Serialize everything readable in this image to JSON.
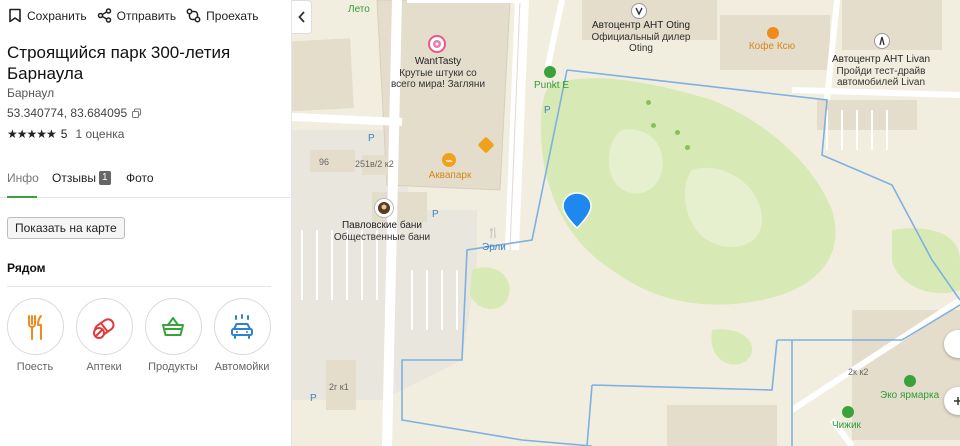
{
  "actions": {
    "save": "Сохранить",
    "send": "Отправить",
    "route": "Проехать"
  },
  "place": {
    "title": "Строящийся парк 300-летия Барнаула",
    "city": "Барнаул",
    "coords": "53.340774, 83.684095",
    "stars": "★★★★★",
    "rating": "5",
    "reviews": "1 оценка"
  },
  "tabs": {
    "info": "Инфо",
    "reviews": "Отзывы",
    "reviews_count": "1",
    "photo": "Фото"
  },
  "show_on_map": "Показать на карте",
  "nearby": {
    "title": "Рядом",
    "items": [
      {
        "label": "Поесть",
        "icon": "fork-knife-icon"
      },
      {
        "label": "Аптеки",
        "icon": "pills-icon"
      },
      {
        "label": "Продукты",
        "icon": "basket-icon"
      },
      {
        "label": "Автомойки",
        "icon": "car-wash-icon"
      }
    ]
  },
  "map": {
    "street_leto": "Лето",
    "wanttasty": {
      "name": "WantTasty",
      "desc1": "Крутые штуки со",
      "desc2": "всего мира! Загляни"
    },
    "aquapark": "Аквапарк",
    "banya": {
      "name": "Павловские бани",
      "desc": "Общественные бани"
    },
    "erli": "Эрли",
    "punkt_e": "Punkt E",
    "oting": {
      "name": "Автоцентр АНТ Oting",
      "desc1": "Официальный дилер",
      "desc2": "Oting"
    },
    "coffee": "Кофе Ксю",
    "livan": {
      "name": "Автоцентр АНТ Livan",
      "desc1": "Пройди тест-драйв",
      "desc2": "автомобилей Livan"
    },
    "eko": "Эко ярмарка",
    "chizhik": "Чижик",
    "house_96": "96",
    "house_251": "251в/2 к2",
    "house_2g": "2г к1",
    "house_2k": "2к к2",
    "parking": "P",
    "colors": {
      "park": "#d7e9b4",
      "boundary": "#7eb0e2",
      "pin": "#1e88f0",
      "road": "#ffffff",
      "building": "#e4ddcc"
    }
  }
}
